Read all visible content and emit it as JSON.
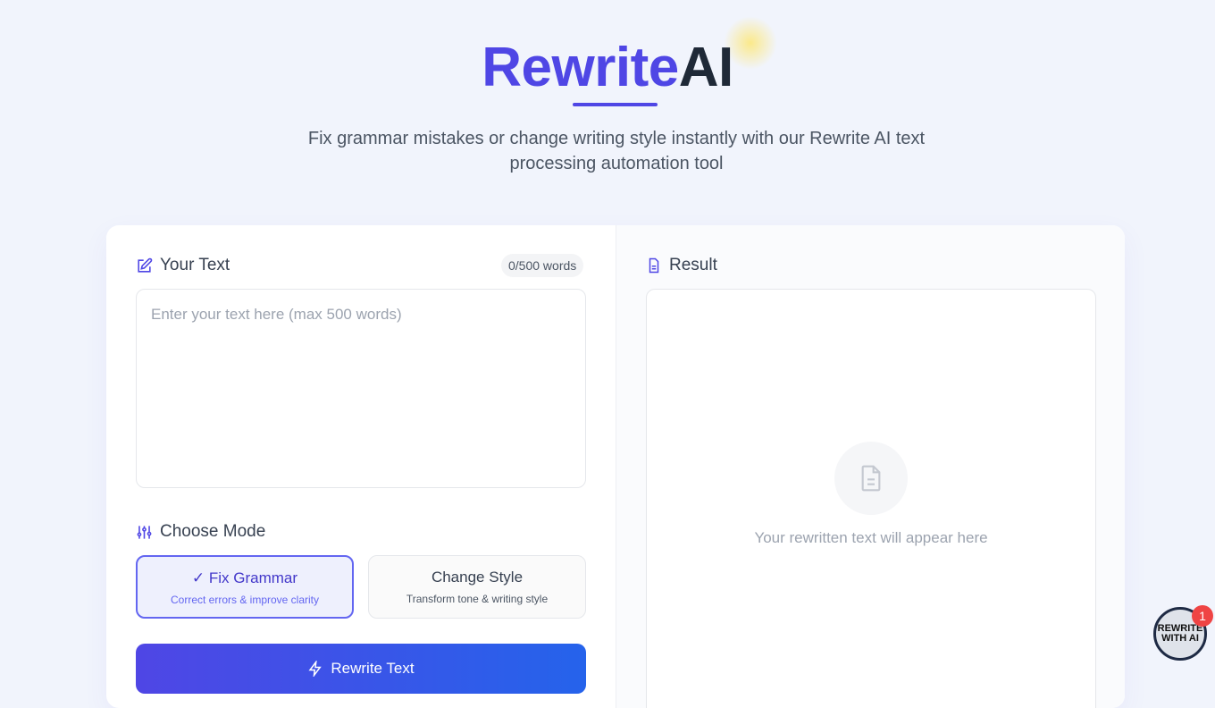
{
  "header": {
    "title_a": "Rewrite",
    "title_b": "AI",
    "subtitle": "Fix grammar mistakes or change writing style instantly with our Rewrite AI text processing automation tool"
  },
  "input": {
    "label": "Your Text",
    "word_count": "0/500 words",
    "placeholder": "Enter your text here (max 500 words)",
    "value": ""
  },
  "modes": {
    "label": "Choose Mode",
    "items": [
      {
        "title": "Fix Grammar",
        "desc": "Correct errors & improve clarity",
        "selected": true
      },
      {
        "title": "Change Style",
        "desc": "Transform tone & writing style",
        "selected": false
      }
    ]
  },
  "submit_label": "Rewrite Text",
  "result": {
    "label": "Result",
    "placeholder": "Your rewritten text will appear here"
  },
  "widget": {
    "logo_text": "REWRITE WITH AI",
    "badge": "1"
  },
  "colors": {
    "accent": "#4f46e5",
    "button_end": "#2563eb",
    "notif": "#ef4444"
  }
}
